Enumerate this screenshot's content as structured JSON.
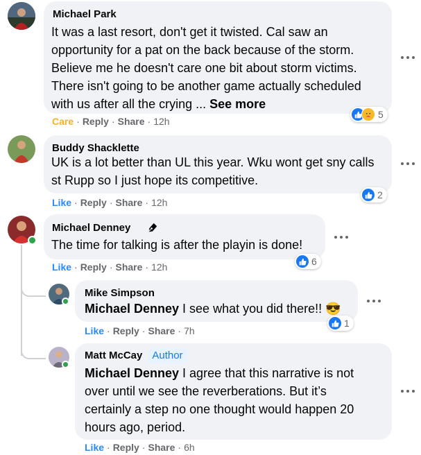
{
  "colors": {
    "accent": "#1877f2",
    "care": "#f7b125",
    "bubble": "#f0f2f5",
    "meta": "#65676b",
    "online": "#31a24c"
  },
  "comments": [
    {
      "name": "Michael Park",
      "text": "It was a last resort, don't get it twisted. Cal saw an opportunity for a pat on the back because of the storm. Believe me he doesn't care one bit about storm victims. There isn't going to be another game actually scheduled with us after all the crying ... ",
      "see_more": "See more",
      "reaction_label": "Care",
      "reply": "Reply",
      "share": "Share",
      "time": "12h",
      "reaction_count": "5",
      "reaction_icons": [
        "like-icon",
        "care-icon"
      ]
    },
    {
      "name": "Buddy Shacklette",
      "text": "UK is a lot better than UL this year. Wku wont get sny calls st Rupp so I just hope its competitive.",
      "reaction_label": "Like",
      "reply": "Reply",
      "share": "Share",
      "time": "12h",
      "reaction_count": "2",
      "reaction_icons": [
        "like-icon"
      ]
    },
    {
      "name": "Michael Denney",
      "badge_icon": "pen-nib-icon",
      "text": "The time for talking is after the playin is done!",
      "reaction_label": "Like",
      "reply": "Reply",
      "share": "Share",
      "time": "12h",
      "reaction_count": "6",
      "reaction_icons": [
        "like-icon"
      ],
      "replies": [
        {
          "name": "Mike Simpson",
          "mention": "Michael Denney",
          "text": " I see what you did there!! 😎",
          "reaction_label": "Like",
          "reply": "Reply",
          "share": "Share",
          "time": "7h",
          "reaction_count": "1",
          "reaction_icons": [
            "like-icon"
          ]
        },
        {
          "name": "Matt McCay",
          "author_badge": "Author",
          "mention": "Michael Denney",
          "text": " I agree that this narrative is not over until we see the reverberations. But it’s certainly a step no one thought would happen 20 hours ago, period.",
          "reaction_label": "Like",
          "reply": "Reply",
          "share": "Share",
          "time": "6h"
        }
      ]
    }
  ]
}
